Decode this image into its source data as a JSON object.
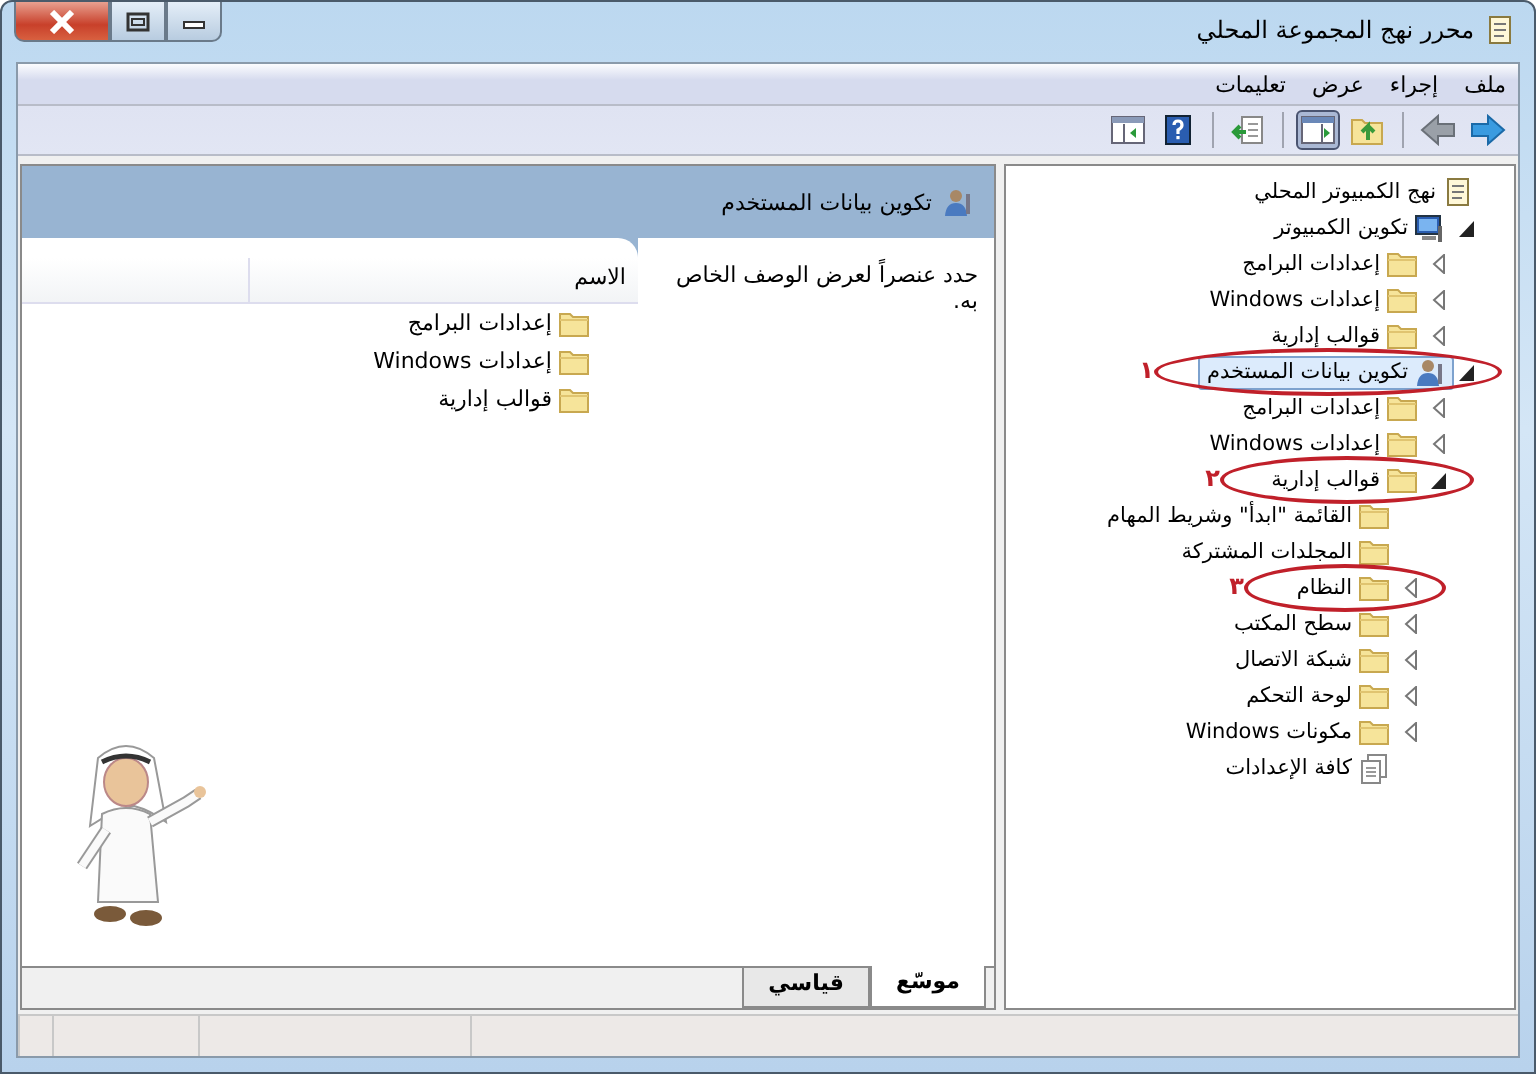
{
  "window": {
    "title": "محرر نهج المجموعة المحلي"
  },
  "menu": [
    "ملف",
    "إجراء",
    "عرض",
    "تعليمات"
  ],
  "toolbar": [
    {
      "kind": "forward",
      "pressed": false
    },
    {
      "kind": "back",
      "pressed": false
    },
    {
      "kind": "separator"
    },
    {
      "kind": "up",
      "pressed": false
    },
    {
      "kind": "tree",
      "pressed": true
    },
    {
      "kind": "separator"
    },
    {
      "kind": "export",
      "pressed": false
    },
    {
      "kind": "separator"
    },
    {
      "kind": "help",
      "pressed": false
    },
    {
      "kind": "pane",
      "pressed": false
    }
  ],
  "tree": [
    {
      "label": "نهج الكمبيوتر المحلي",
      "kind": "policy",
      "expandable": false,
      "selected": false,
      "children": [
        {
          "label": "تكوين الكمبيوتر",
          "kind": "computer",
          "expandable": true,
          "expanded": true,
          "selected": false,
          "children": [
            {
              "label": "إعدادات البرامج",
              "kind": "folder",
              "expandable": true,
              "expanded": false,
              "selected": false
            },
            {
              "label": "إعدادات Windows",
              "kind": "folder",
              "expandable": true,
              "expanded": false,
              "selected": false
            },
            {
              "label": "قوالب إدارية",
              "kind": "folder",
              "expandable": true,
              "expanded": false,
              "selected": false
            }
          ]
        },
        {
          "label": "تكوين بيانات المستخدم",
          "kind": "user",
          "expandable": true,
          "expanded": true,
          "selected": true,
          "annotation": "١",
          "children": [
            {
              "label": "إعدادات البرامج",
              "kind": "folder",
              "expandable": true,
              "expanded": false,
              "selected": false
            },
            {
              "label": "إعدادات Windows",
              "kind": "folder",
              "expandable": true,
              "expanded": false,
              "selected": false
            },
            {
              "label": "قوالب إدارية",
              "kind": "folder",
              "expandable": true,
              "expanded": true,
              "selected": false,
              "annotation": "٢",
              "children": [
                {
                  "label": "القائمة \"ابدأ\" وشريط المهام",
                  "kind": "folder",
                  "expandable": false,
                  "selected": false
                },
                {
                  "label": "المجلدات المشتركة",
                  "kind": "folder",
                  "expandable": false,
                  "selected": false
                },
                {
                  "label": "النظام",
                  "kind": "folder",
                  "expandable": true,
                  "expanded": false,
                  "selected": false,
                  "annotation": "٣"
                },
                {
                  "label": "سطح المكتب",
                  "kind": "folder",
                  "expandable": true,
                  "expanded": false,
                  "selected": false
                },
                {
                  "label": "شبكة الاتصال",
                  "kind": "folder",
                  "expandable": true,
                  "expanded": false,
                  "selected": false
                },
                {
                  "label": "لوحة التحكم",
                  "kind": "folder",
                  "expandable": true,
                  "expanded": false,
                  "selected": false
                },
                {
                  "label": "مكونات Windows",
                  "kind": "folder",
                  "expandable": true,
                  "expanded": false,
                  "selected": false
                },
                {
                  "label": "كافة الإعدادات",
                  "kind": "settings",
                  "expandable": false,
                  "selected": false
                }
              ]
            }
          ]
        }
      ]
    }
  ],
  "details": {
    "title": "تكوين بيانات المستخدم",
    "description": "حدد عنصراً لعرض الوصف الخاص به.",
    "columns": [
      "الاسم"
    ],
    "items": [
      {
        "label": "إعدادات البرامج"
      },
      {
        "label": "إعدادات Windows"
      },
      {
        "label": "قوالب إدارية"
      }
    ]
  },
  "view_tabs": [
    {
      "label": "موسّع",
      "selected": true
    },
    {
      "label": "قياسي",
      "selected": false
    }
  ]
}
